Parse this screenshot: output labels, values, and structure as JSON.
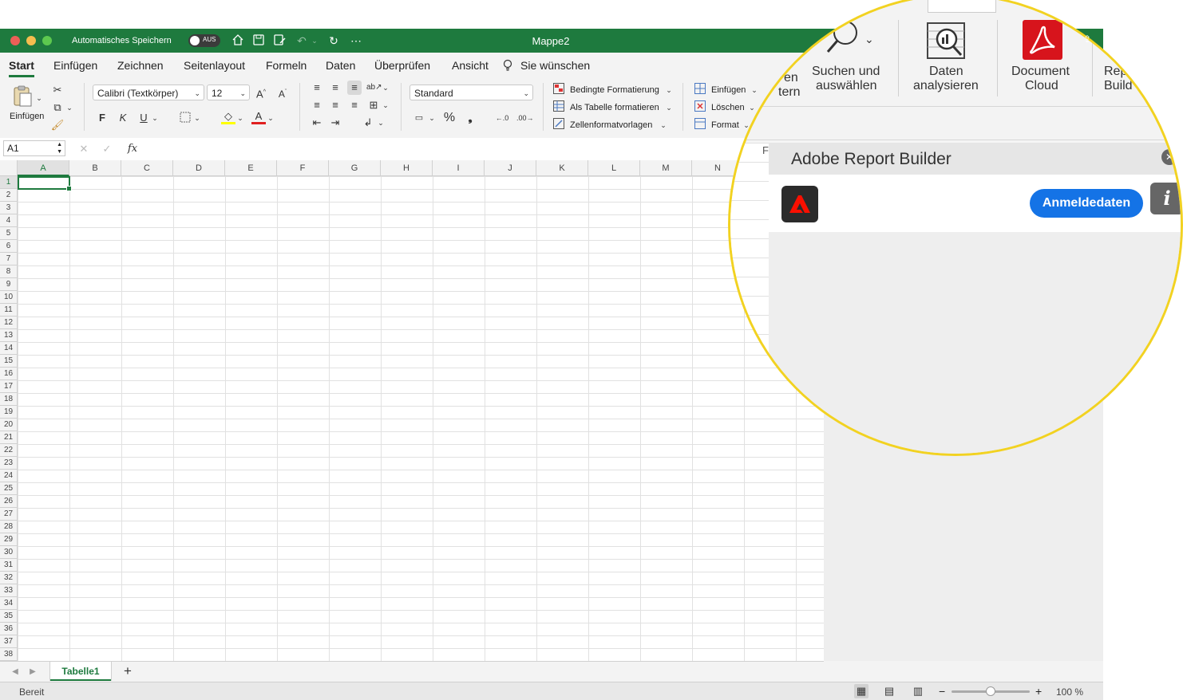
{
  "titlebar": {
    "autosave_label": "Automatisches Speichern",
    "autosave_state": "AUS",
    "title": "Mappe2"
  },
  "menubar": {
    "items": [
      "Start",
      "Einfügen",
      "Zeichnen",
      "Seitenlayout",
      "Formeln",
      "Daten",
      "Überprüfen",
      "Ansicht"
    ],
    "tell_me": "Sie wünschen"
  },
  "ribbon": {
    "paste_label": "Einfügen",
    "font_name": "Calibri (Textkörper)",
    "font_size": "12",
    "bold": "F",
    "italic": "K",
    "underline": "U",
    "number_format": "Standard",
    "percent": "%",
    "comma": "❟",
    "conditional_formatting": "Bedingte Formatierung",
    "format_as_table": "Als Tabelle formatieren",
    "cell_styles": "Zellenformatvorlagen",
    "insert": "Einfügen",
    "delete": "Löschen",
    "format": "Format",
    "accent_color": "#1e7a3e"
  },
  "formulabar": {
    "namebox": "A1",
    "fx": "fx",
    "value": ""
  },
  "grid": {
    "columns": [
      "A",
      "B",
      "C",
      "D",
      "E",
      "F",
      "G",
      "H",
      "I",
      "J",
      "K",
      "L",
      "M",
      "N"
    ],
    "rows": [
      "1",
      "2",
      "3",
      "4",
      "5",
      "6",
      "7",
      "8",
      "9",
      "10",
      "11",
      "12",
      "13",
      "14",
      "15",
      "16",
      "17",
      "18",
      "19",
      "20",
      "21",
      "22",
      "23",
      "24",
      "25",
      "26",
      "27",
      "28",
      "29",
      "30",
      "31",
      "32",
      "33",
      "34",
      "35",
      "36",
      "37",
      "38"
    ],
    "selected_cell": "A1"
  },
  "sheets": {
    "active": "Tabelle1",
    "add_label": "+"
  },
  "statusbar": {
    "status": "Bereit",
    "zoom_percent": "100 %",
    "zoom_minus": "−",
    "zoom_plus": "+"
  },
  "magnifier": {
    "ribbon_partial_left_top": "en",
    "ribbon_partial_left_bottom": "tern",
    "find_select_line1": "Suchen und",
    "find_select_line2": "auswählen",
    "analyze_line1": "Daten",
    "analyze_line2": "analysieren",
    "doc_cloud_line1": "Document",
    "doc_cloud_line2": "Cloud",
    "report_builder_partial_line1": "Rep",
    "report_builder_partial_line2": "Build",
    "panel_title": "Adobe Report Builder",
    "panel_partial_letter": "F",
    "signin_button": "Anmeldedaten",
    "info_button": "i",
    "highlight_color": "#f2d221",
    "signin_color": "#1473e6"
  }
}
